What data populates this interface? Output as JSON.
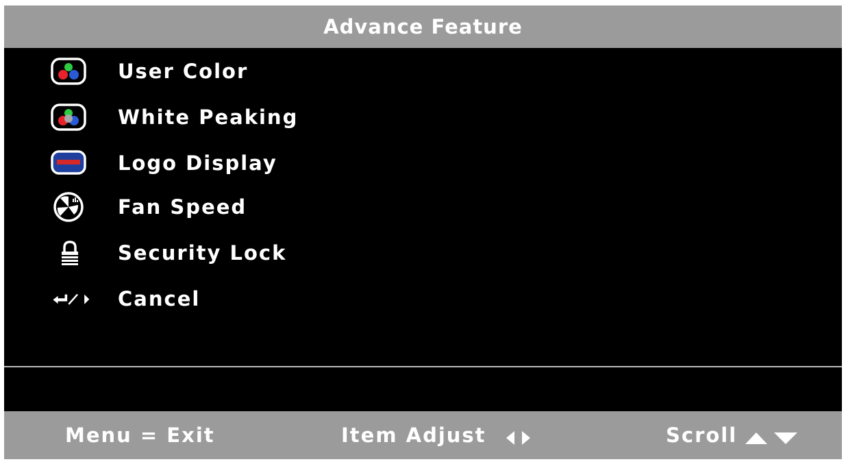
{
  "header": {
    "title": "Advance Feature"
  },
  "menu": {
    "items": [
      {
        "label": "User Color",
        "icon": "color-balls-icon"
      },
      {
        "label": "White Peaking",
        "icon": "white-peaking-icon"
      },
      {
        "label": "Logo Display",
        "icon": "logo-display-icon"
      },
      {
        "label": "Fan Speed",
        "icon": "fan-icon"
      },
      {
        "label": "Security Lock",
        "icon": "lock-icon"
      },
      {
        "label": "Cancel",
        "icon": "enter-right-icon"
      }
    ]
  },
  "footer": {
    "menu_hint": "Menu = Exit",
    "adjust_hint": "Item Adjust",
    "scroll_hint": "Scroll"
  },
  "colors": {
    "panel_bg": "#000000",
    "bar_bg": "#9b9b9b",
    "text": "#ffffff"
  }
}
